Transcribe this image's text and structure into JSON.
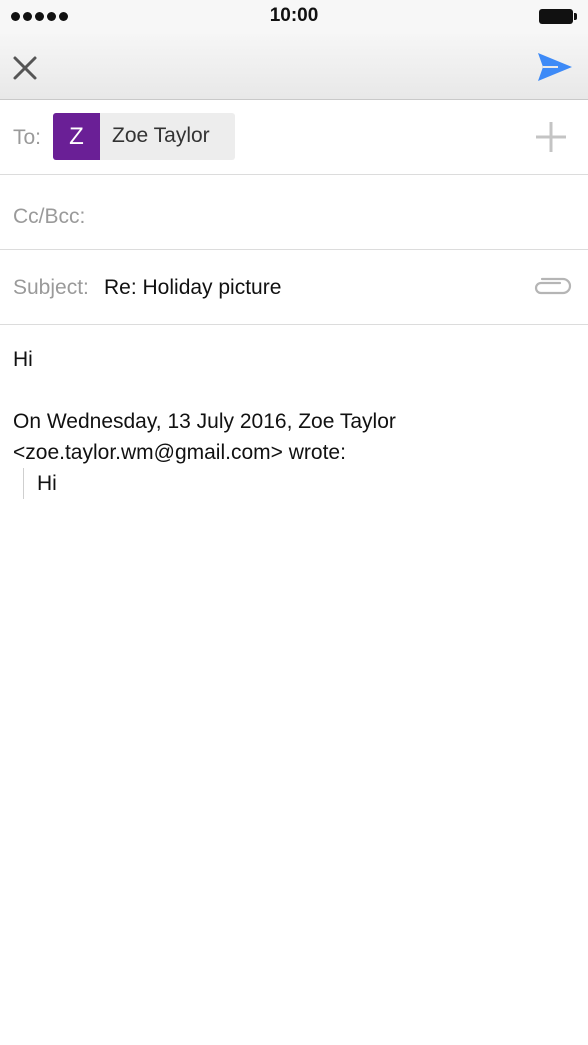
{
  "status_bar": {
    "time": "10:00",
    "signal_icon": "signal-dots-icon",
    "battery_icon": "battery-icon"
  },
  "toolbar": {
    "close_icon": "close-icon",
    "send_icon": "send-icon",
    "send_color": "#3d8af7"
  },
  "recipients": {
    "to_label": "To:",
    "chip": {
      "initial": "Z",
      "name": "Zoe Taylor",
      "avatar_color": "#6a1f96"
    },
    "add_icon": "plus-icon",
    "cc_label": "Cc/Bcc:"
  },
  "subject": {
    "label": "Subject:",
    "value": "Re: Holiday picture",
    "attach_icon": "paperclip-icon"
  },
  "body": {
    "greeting": "Hi",
    "attribution_line1": "On Wednesday, 13 July 2016, Zoe Taylor",
    "attribution_line2": "<zoe.taylor.wm@gmail.com> wrote:",
    "quoted_text": "Hi"
  }
}
